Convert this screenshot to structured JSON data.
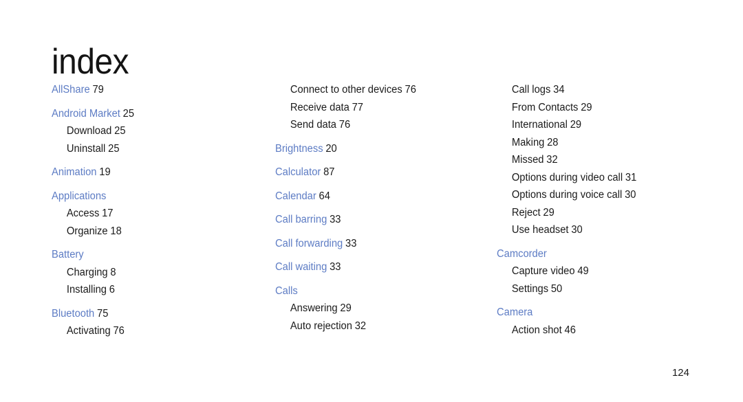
{
  "document": {
    "title": "index",
    "page_number": "124",
    "heading_color": "#5d7cc4",
    "body_color": "#1a1a1a",
    "background_color": "#ffffff"
  },
  "columns": [
    {
      "id": "column-1",
      "groups": [
        {
          "heading": "AllShare",
          "page": "79",
          "subentries": []
        },
        {
          "heading": "Android Market",
          "page": "25",
          "subentries": [
            {
              "label": "Download",
              "page": "25"
            },
            {
              "label": "Uninstall",
              "page": "25"
            }
          ]
        },
        {
          "heading": "Animation",
          "page": "19",
          "subentries": []
        },
        {
          "heading": "Applications",
          "page": "",
          "subentries": [
            {
              "label": "Access",
              "page": "17"
            },
            {
              "label": "Organize",
              "page": "18"
            }
          ]
        },
        {
          "heading": "Battery",
          "page": "",
          "subentries": [
            {
              "label": "Charging",
              "page": "8"
            },
            {
              "label": "Installing",
              "page": "6"
            }
          ]
        },
        {
          "heading": "Bluetooth",
          "page": "75",
          "subentries": [
            {
              "label": "Activating",
              "page": "76"
            }
          ]
        }
      ]
    },
    {
      "id": "column-2",
      "continuation": [
        {
          "label": "Connect to other devices",
          "page": "76"
        },
        {
          "label": "Receive data",
          "page": "77"
        },
        {
          "label": "Send data",
          "page": "76"
        }
      ],
      "groups": [
        {
          "heading": "Brightness",
          "page": "20",
          "subentries": []
        },
        {
          "heading": "Calculator",
          "page": "87",
          "subentries": []
        },
        {
          "heading": "Calendar",
          "page": "64",
          "subentries": []
        },
        {
          "heading": "Call barring",
          "page": "33",
          "subentries": []
        },
        {
          "heading": "Call forwarding",
          "page": "33",
          "subentries": []
        },
        {
          "heading": "Call waiting",
          "page": "33",
          "subentries": []
        },
        {
          "heading": "Calls",
          "page": "",
          "subentries": [
            {
              "label": "Answering",
              "page": "29"
            },
            {
              "label": "Auto rejection",
              "page": "32"
            }
          ]
        }
      ]
    },
    {
      "id": "column-3",
      "continuation": [
        {
          "label": "Call logs",
          "page": "34"
        },
        {
          "label": "From Contacts",
          "page": "29"
        },
        {
          "label": "International",
          "page": "29"
        },
        {
          "label": "Making",
          "page": "28"
        },
        {
          "label": "Missed",
          "page": "32"
        },
        {
          "label": "Options during video call",
          "page": "31"
        },
        {
          "label": "Options during voice call",
          "page": "30"
        },
        {
          "label": "Reject",
          "page": "29"
        },
        {
          "label": "Use headset",
          "page": "30"
        }
      ],
      "groups": [
        {
          "heading": "Camcorder",
          "page": "",
          "subentries": [
            {
              "label": "Capture video",
              "page": "49"
            },
            {
              "label": "Settings",
              "page": "50"
            }
          ]
        },
        {
          "heading": "Camera",
          "page": "",
          "subentries": [
            {
              "label": "Action shot",
              "page": "46"
            }
          ]
        }
      ]
    }
  ]
}
